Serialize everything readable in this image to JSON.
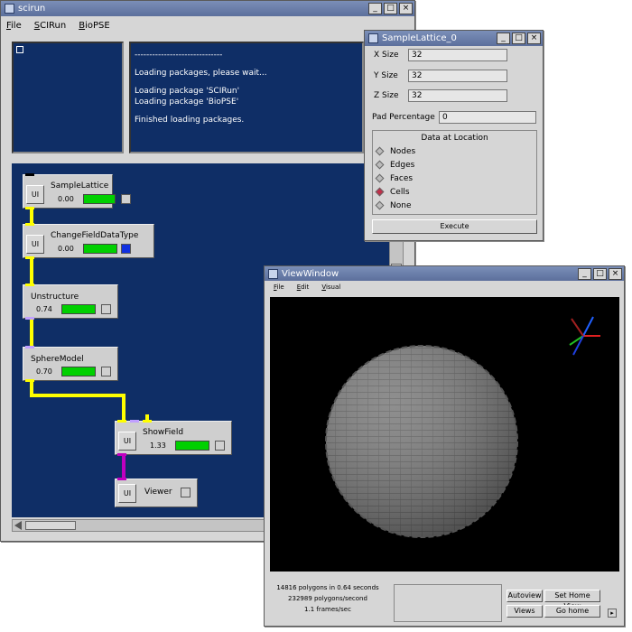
{
  "scirun": {
    "title": "scirun",
    "menu": [
      "File",
      "SCIRun",
      "BioPSE"
    ],
    "log": [
      "------------------------------",
      "Loading packages, please wait...",
      "Loading package 'SCIRun'",
      "Loading package 'BioPSE'",
      "Finished loading packages."
    ],
    "modules": [
      {
        "name": "SampleLattice",
        "time": "0.00",
        "ui": "UI"
      },
      {
        "name": "ChangeFieldDataType",
        "time": "0.00",
        "ui": "UI"
      },
      {
        "name": "Unstructure",
        "time": "0.74",
        "ui": "UI"
      },
      {
        "name": "SphereModel",
        "time": "0.70",
        "ui": "UI"
      },
      {
        "name": "ShowField",
        "time": "1.33",
        "ui": "UI"
      },
      {
        "name": "Viewer",
        "ui": "UI"
      }
    ]
  },
  "sample_lattice": {
    "title": "SampleLattice_0",
    "x_label": "X Size",
    "x_value": "32",
    "y_label": "Y Size",
    "y_value": "32",
    "z_label": "Z Size",
    "z_value": "32",
    "pad_label": "Pad Percentage",
    "pad_value": "0",
    "group_title": "Data at Location",
    "options": [
      "Nodes",
      "Edges",
      "Faces",
      "Cells",
      "None"
    ],
    "selected": "Cells",
    "execute_label": "Execute"
  },
  "viewwindow": {
    "title": "ViewWindow",
    "menu": [
      "File",
      "Edit",
      "Visual"
    ],
    "stats": [
      "14816 polygons in 0.64 seconds",
      "232989 polygons/second",
      "1.1 frames/sec"
    ],
    "buttons": {
      "autoview": "Autoview",
      "set_home": "Set Home View",
      "views": "Views",
      "go_home": "Go home"
    }
  },
  "colors": {
    "title_bar": "#5c6f9c",
    "canvas": "#0f2e66",
    "progress": "#00d000",
    "pipe_yellow": "#ffff00",
    "pipe_magenta": "#c000c0"
  }
}
